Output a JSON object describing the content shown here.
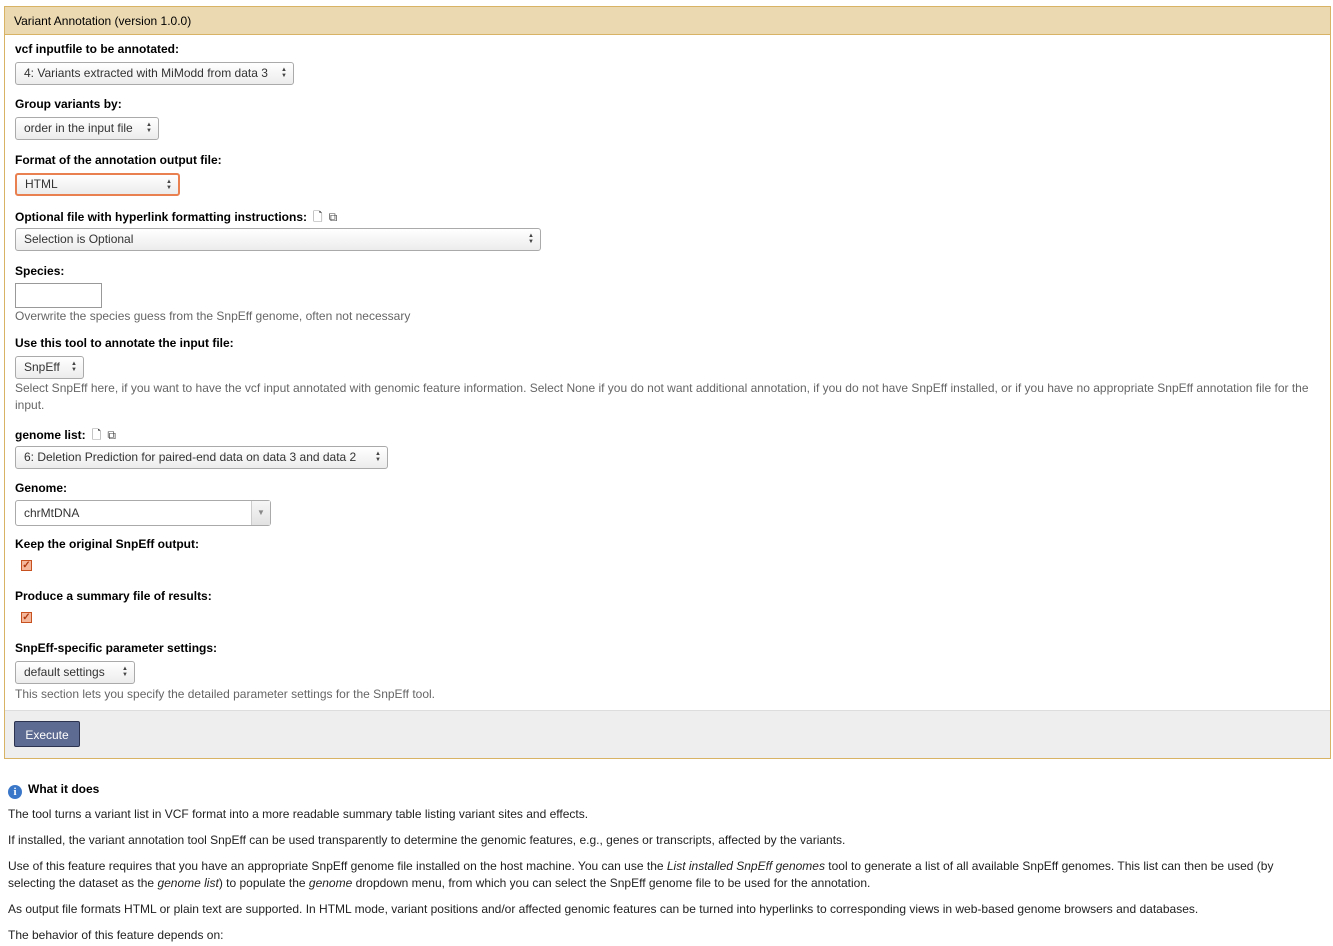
{
  "panel": {
    "title": "Variant Annotation (version 1.0.0)"
  },
  "fields": {
    "vcf": {
      "label": "vcf inputfile to be annotated:",
      "value": "4: Variants extracted with MiModd from data 3"
    },
    "group": {
      "label": "Group variants by:",
      "value": "order in the input file"
    },
    "format": {
      "label": "Format of the annotation output file:",
      "value": "HTML"
    },
    "hyperlink": {
      "label": "Optional file with hyperlink formatting instructions:",
      "value": "Selection is Optional",
      "icons": [
        "file-icon",
        "copy-icon"
      ]
    },
    "species": {
      "label": "Species:",
      "value": "",
      "help": "Overwrite the species guess from the SnpEff genome, often not necessary"
    },
    "tool": {
      "label": "Use this tool to annotate the input file:",
      "value": "SnpEff",
      "help": "Select SnpEff here, if you want to have the vcf input annotated with genomic feature information. Select None if you do not want additional annotation, if you do not have SnpEff installed, or if you have no appropriate SnpEff annotation file for the input."
    },
    "genome_list": {
      "label": "genome list:",
      "value": "6: Deletion Prediction for paired-end data on data 3 and data 2",
      "icons": [
        "file-icon",
        "copy-icon"
      ]
    },
    "genome": {
      "label": "Genome:",
      "value": "chrMtDNA"
    },
    "keep_output": {
      "label": "Keep the original SnpEff output:",
      "checked": true
    },
    "summary": {
      "label": "Produce a summary file of results:",
      "checked": true
    },
    "snpeff_settings": {
      "label": "SnpEff-specific parameter settings:",
      "value": "default settings",
      "help": "This section lets you specify the detailed parameter settings for the SnpEff tool."
    }
  },
  "execute_label": "Execute",
  "doc": {
    "title": "What it does",
    "p1": "The tool turns a variant list in VCF format into a more readable summary table listing variant sites and effects.",
    "p2": "If installed, the variant annotation tool SnpEff can be used transparently to determine the genomic features, e.g., genes or transcripts, affected by the variants.",
    "p3_a": "Use of this feature requires that you have an appropriate SnpEff genome file installed on the host machine. You can use the ",
    "p3_em1": "List installed SnpEff genomes",
    "p3_b": " tool to generate a list of all available SnpEff genomes. This list can then be used (by selecting the dataset as the ",
    "p3_em2": "genome list",
    "p3_c": ") to populate the ",
    "p3_em3": "genome",
    "p3_d": " dropdown menu, from which you can select the SnpEff genome file to be used for the annotation.",
    "p4": "As output file formats HTML or plain text are supported. In HTML mode, variant positions and/or affected genomic features can be turned into hyperlinks to corresponding views in web-based genome browsers and databases.",
    "p5": "The behavior of this feature depends on:"
  }
}
